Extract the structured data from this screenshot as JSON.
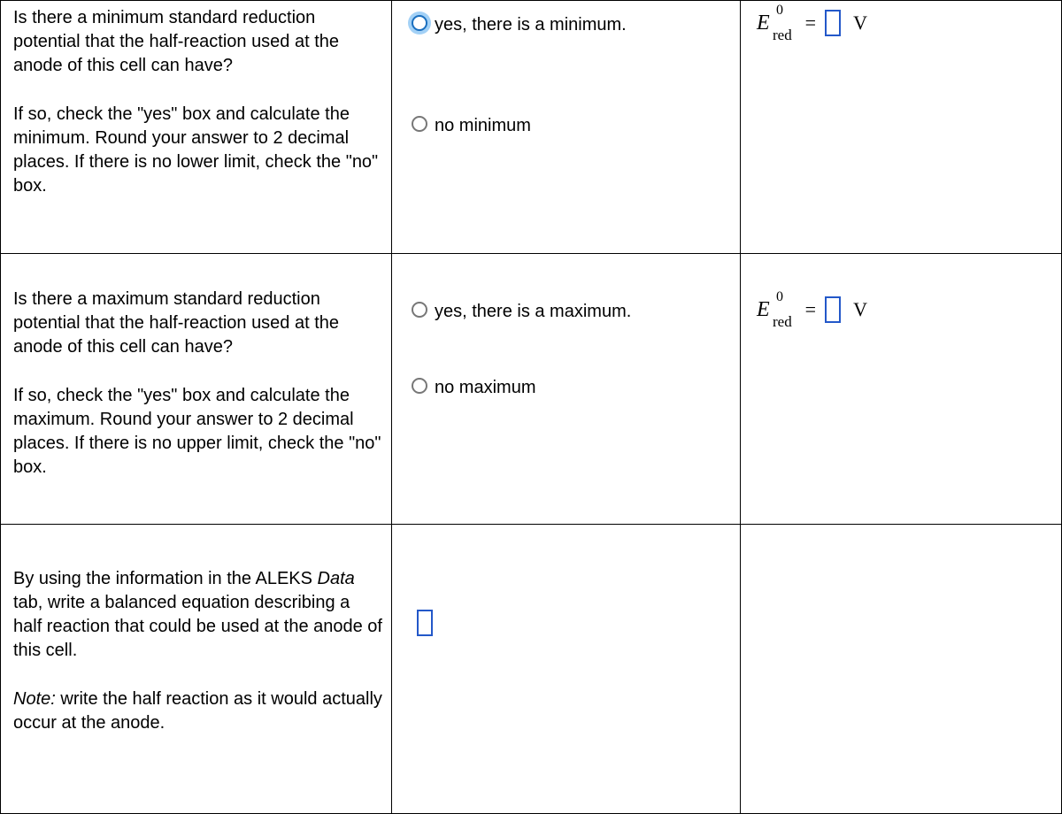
{
  "rows": [
    {
      "question_p1": "Is there a minimum standard reduction potential that the half-reaction used at the anode of this cell can have?",
      "question_p2": "If so, check the \"yes\" box and calculate the minimum. Round your answer to 2 decimal places. If there is no lower limit, check the \"no\" box.",
      "opt_yes": "yes, there is a minimum.",
      "opt_no": "no minimum",
      "symbol_E": "E",
      "sup": "0",
      "sub": "red",
      "equals": "=",
      "unit": "V",
      "yes_selected_focus": true
    },
    {
      "question_p1": "Is there a maximum standard reduction potential that the half-reaction used at the anode of this cell can have?",
      "question_p2": "If so, check the \"yes\" box and calculate the maximum. Round your answer to 2 decimal places. If there is no upper limit, check the \"no\" box.",
      "opt_yes": "yes, there is a maximum.",
      "opt_no": "no maximum",
      "symbol_E": "E",
      "sup": "0",
      "sub": "red",
      "equals": "=",
      "unit": "V",
      "yes_selected_focus": false
    },
    {
      "question_p1_pre": "By using the information in the ALEKS ",
      "question_p1_it": "Data",
      "question_p1_post": " tab, write a balanced equation describing a half reaction that could be used at the anode of this cell.",
      "question_p2_it": "Note:",
      "question_p2_post": " write the half reaction as it would actually occur at the anode."
    }
  ]
}
